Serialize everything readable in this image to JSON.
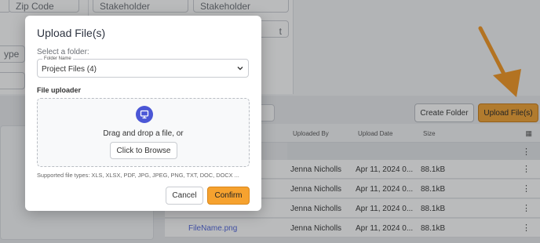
{
  "background": {
    "fields": {
      "zip_code": "Zip Code",
      "stakeholder_company": "Stakeholder Company",
      "stakeholder_contact": "Stakeholder Contact",
      "partial_ype": "ype",
      "partial_t": "t"
    },
    "toolbar": {
      "create_folder": "Create Folder",
      "upload_files": "Upload File(s)"
    },
    "table": {
      "headers": [
        "Uploaded By",
        "Upload Date",
        "Size"
      ],
      "rows": [
        {
          "name": "",
          "uploaded_by": "Jenna Nicholls",
          "date": "Apr 11, 2024 0...",
          "size": "88.1kB"
        },
        {
          "name": "",
          "uploaded_by": "Jenna Nicholls",
          "date": "Apr 11, 2024 0...",
          "size": "88.1kB"
        },
        {
          "name": "",
          "uploaded_by": "Jenna Nicholls",
          "date": "Apr 11, 2024 0...",
          "size": "88.1kB"
        },
        {
          "name": "FileName.png",
          "uploaded_by": "Jenna Nicholls",
          "date": "Apr 11, 2024 0...",
          "size": "88.1kB"
        }
      ]
    },
    "accent_color": "#f2a12e",
    "arrow_color": "#f5961c"
  },
  "modal": {
    "title": "Upload File(s)",
    "select_folder_label": "Select a folder:",
    "folder_field_label": "Folder Name",
    "folder_value": "Project Files (4)",
    "uploader_label": "File uploader",
    "drop_text": "Drag and drop a file, or",
    "browse_label": "Click to Browse",
    "supported_types": "Supported file types: XLS, XLSX, PDF, JPG, JPEG, PNG, TXT, DOC, DOCX ...",
    "cancel_label": "Cancel",
    "confirm_label": "Confirm",
    "icons": {
      "upload_area": "monitor-icon",
      "select": "chevron-down-icon"
    }
  }
}
